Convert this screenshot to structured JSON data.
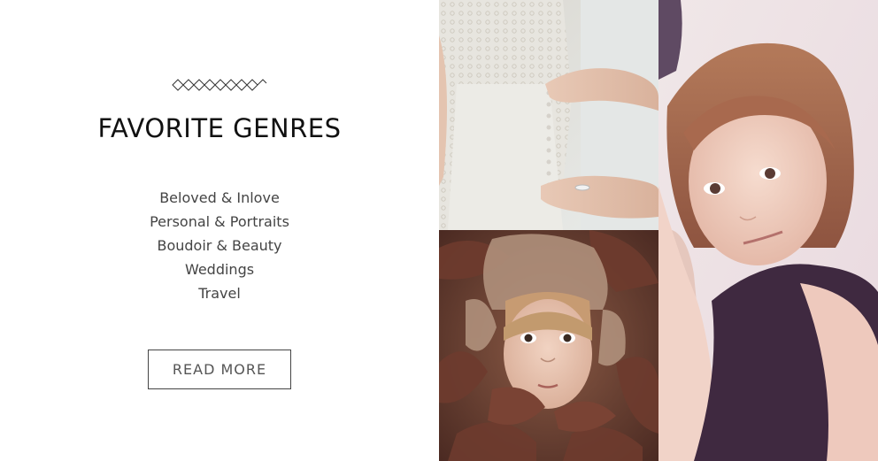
{
  "section": {
    "title": "FAVORITE GENRES",
    "genres": [
      "Beloved & Inlove",
      "Personal & Portraits",
      "Boudoir & Beauty",
      "Weddings",
      "Travel"
    ],
    "read_more_label": "READ MORE",
    "ornament_icon": "diamond-chain-icon"
  },
  "gallery": {
    "images": [
      {
        "subject": "bride-dress-photo"
      },
      {
        "subject": "child-in-autumn-leaves-photo"
      },
      {
        "subject": "girl-portrait-photo"
      }
    ]
  }
}
